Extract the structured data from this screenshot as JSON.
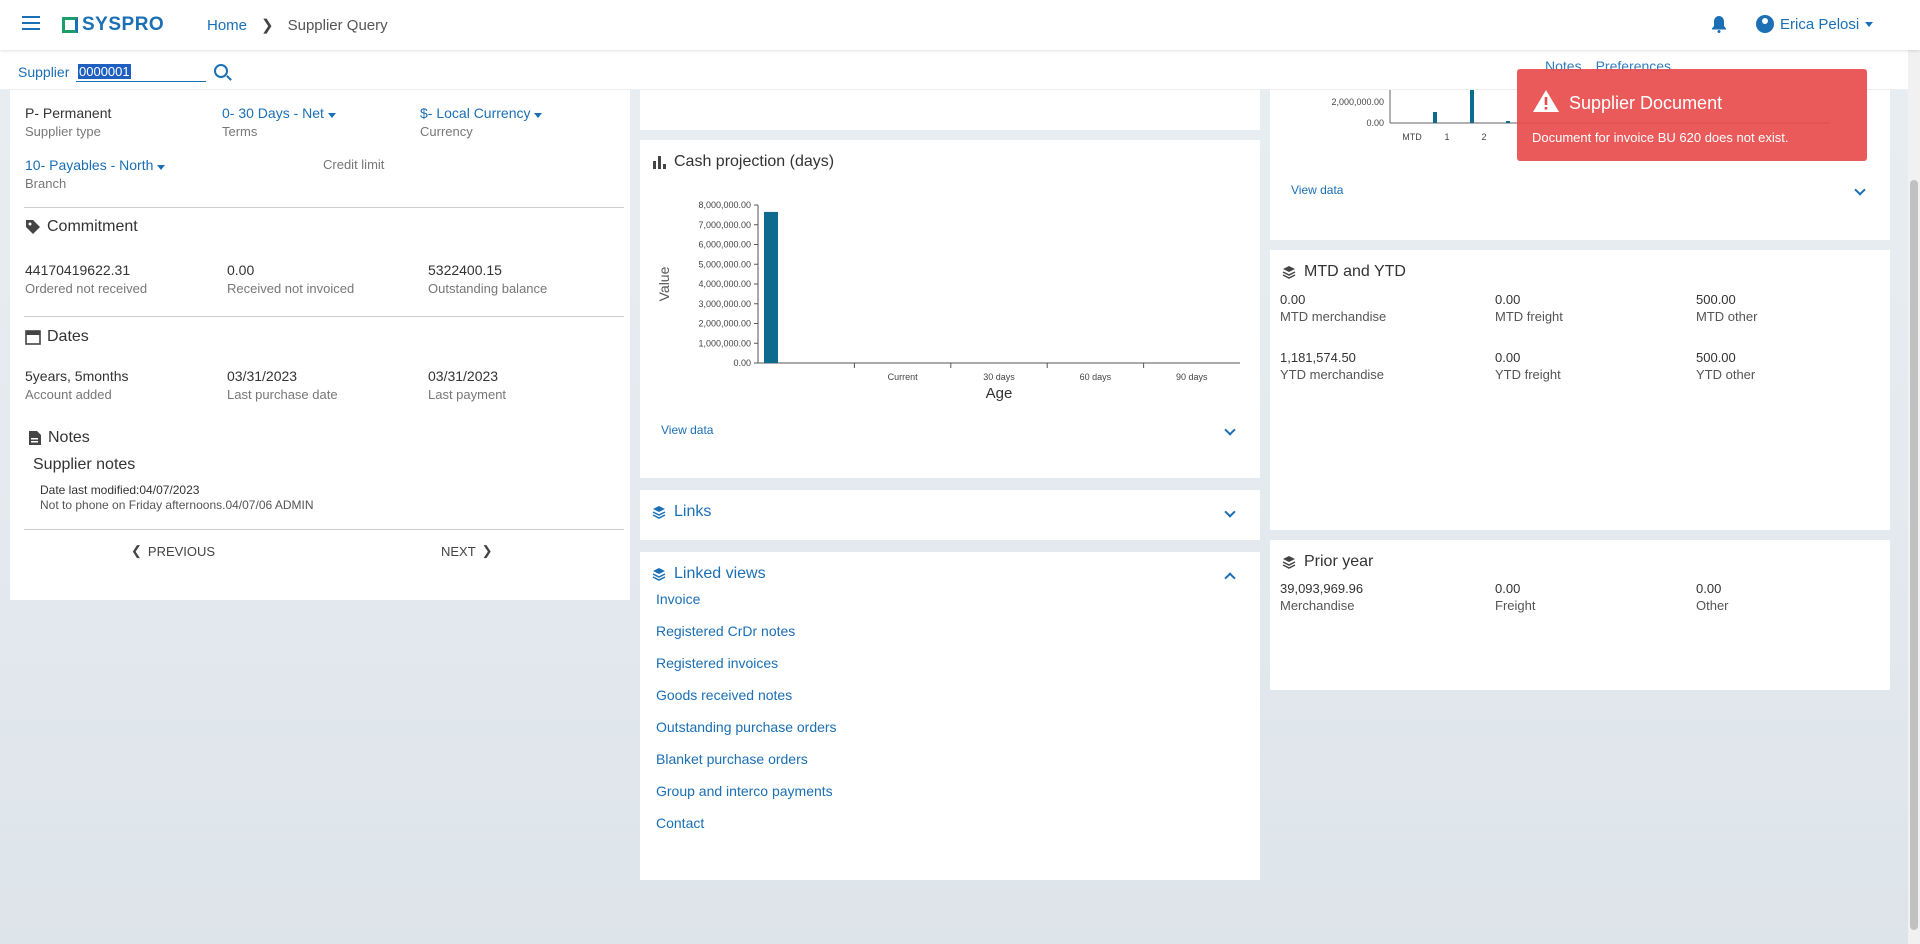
{
  "header": {
    "logo": "SYSPRO",
    "breadcrumb_home": "Home",
    "breadcrumb_current": "Supplier Query",
    "user_name": "Erica Pelosi"
  },
  "supplier_bar": {
    "label": "Supplier",
    "value": "0000001",
    "toolbar": [
      "Notes",
      "Preferences"
    ]
  },
  "toast": {
    "title": "Supplier Document",
    "message": "Document for invoice BU 620 does not exist."
  },
  "details": {
    "supplier_type": {
      "value": "P- Permanent",
      "label": "Supplier type"
    },
    "terms": {
      "value": "0- 30 Days - Net",
      "label": "Terms"
    },
    "currency": {
      "value": "$- Local Currency",
      "label": "Currency"
    },
    "branch": {
      "value": "10- Payables - North",
      "label": "Branch"
    },
    "credit_limit": {
      "label": "Credit limit"
    }
  },
  "commitment": {
    "title": "Commitment",
    "items": [
      {
        "value": "44170419622.31",
        "label": "Ordered not received"
      },
      {
        "value": "0.00",
        "label": "Received not invoiced"
      },
      {
        "value": "5322400.15",
        "label": "Outstanding balance"
      }
    ]
  },
  "dates": {
    "title": "Dates",
    "items": [
      {
        "value": "5years, 5months",
        "label": "Account added"
      },
      {
        "value": "03/31/2023",
        "label": "Last purchase date"
      },
      {
        "value": "03/31/2023",
        "label": "Last payment"
      }
    ]
  },
  "notes": {
    "title": "Notes",
    "subtitle": "Supplier notes",
    "modified": "Date last modified:04/07/2023",
    "text": "Not to phone on Friday afternoons.04/07/06 ADMIN",
    "prev": "PREVIOUS",
    "next": "NEXT"
  },
  "cash_projection": {
    "title": "Cash projection (days)",
    "view_data": "View data"
  },
  "chart_data": [
    {
      "type": "bar",
      "title": "Cash projection (days)",
      "xlabel": "Age",
      "ylabel": "Value",
      "categories": [
        "",
        "Current",
        "30 days",
        "60 days",
        "90 days"
      ],
      "values": [
        7650000,
        0,
        0,
        0,
        0
      ],
      "ylim": [
        0,
        8000000
      ],
      "yticks": [
        "0.00",
        "1,000,000.00",
        "2,000,000.00",
        "3,000,000.00",
        "4,000,000.00",
        "5,000,000.00",
        "6,000,000.00",
        "7,000,000.00",
        "8,000,000.00"
      ],
      "grid": false,
      "color": "#0e6a8e"
    },
    {
      "type": "bar",
      "title": "",
      "categories": [
        "MTD",
        "1",
        "2"
      ],
      "yticks": [
        "0.00",
        "2,000,000.00"
      ],
      "partial_note": "chart partially visible (scrolled)"
    }
  ],
  "right_top": {
    "view_data": "View data"
  },
  "links": {
    "title": "Links"
  },
  "linked_views": {
    "title": "Linked views",
    "items": [
      "Invoice",
      "Registered CrDr notes",
      "Registered invoices",
      "Goods received notes",
      "Outstanding purchase orders",
      "Blanket purchase orders",
      "Group and interco payments",
      "Contact"
    ]
  },
  "mtd_ytd": {
    "title": "MTD and YTD",
    "rows": [
      [
        {
          "value": "0.00",
          "label": "MTD merchandise"
        },
        {
          "value": "0.00",
          "label": "MTD freight"
        },
        {
          "value": "500.00",
          "label": "MTD other"
        }
      ],
      [
        {
          "value": "1,181,574.50",
          "label": "YTD merchandise"
        },
        {
          "value": "0.00",
          "label": "YTD freight"
        },
        {
          "value": "500.00",
          "label": "YTD other"
        }
      ]
    ]
  },
  "prior_year": {
    "title": "Prior year",
    "items": [
      {
        "value": "39,093,969.96",
        "label": "Merchandise"
      },
      {
        "value": "0.00",
        "label": "Freight"
      },
      {
        "value": "0.00",
        "label": "Other"
      }
    ]
  },
  "colors": {
    "accent": "#1a6fb5",
    "toast": "#e84c4c",
    "bar": "#0e6a8e"
  }
}
